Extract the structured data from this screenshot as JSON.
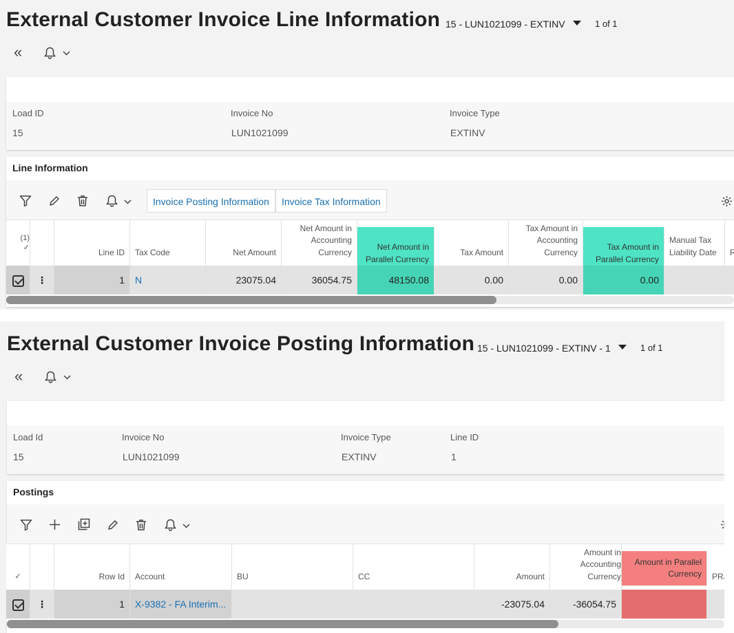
{
  "top": {
    "title": "External Customer Invoice Line Information",
    "selector": "15 - LUN1021099 - EXTINV",
    "pager": "1 of 1",
    "fields": [
      {
        "label": "Load ID",
        "value": "15"
      },
      {
        "label": "Invoice No",
        "value": "LUN1021099"
      },
      {
        "label": "Invoice Type",
        "value": "EXTINV"
      }
    ],
    "section_title": "Line Information",
    "buttons": [
      "Invoice Posting Information",
      "Invoice Tax Information"
    ],
    "selection_count": "(1)",
    "columns": [
      "Line ID",
      "Tax Code",
      "Net Amount",
      "Net Amount in Accounting Currency",
      "Net Amount in Parallel Currency",
      "Tax Amount",
      "Tax Amount in Accounting Currency",
      "Tax Amount in Parallel Currency",
      "Manual Tax Liability Date",
      "R"
    ],
    "row": [
      "1",
      "N",
      "23075.04",
      "36054.75",
      "48150.08",
      "0.00",
      "0.00",
      "0.00",
      ""
    ],
    "highlight_color": "#4ee3c4"
  },
  "bottom": {
    "title": "External Customer Invoice Posting Information",
    "selector": "15 - LUN1021099 - EXTINV - 1",
    "pager": "1 of 1",
    "fields": [
      {
        "label": "Load Id",
        "value": "15"
      },
      {
        "label": "Invoice No",
        "value": "LUN1021099"
      },
      {
        "label": "Invoice Type",
        "value": "EXTINV"
      },
      {
        "label": "Line ID",
        "value": "1"
      }
    ],
    "section_title": "Postings",
    "columns": [
      "Row Id",
      "Account",
      "BU",
      "CC",
      "Amount",
      "Amount in Accounting Currency",
      "Amount in Parallel Currency",
      "PRJ"
    ],
    "row": [
      "1",
      "X-9382 - FA Interim...",
      "",
      "",
      "-23075.04",
      "-36054.75",
      ""
    ],
    "highlight_color": "#f47f7f"
  }
}
